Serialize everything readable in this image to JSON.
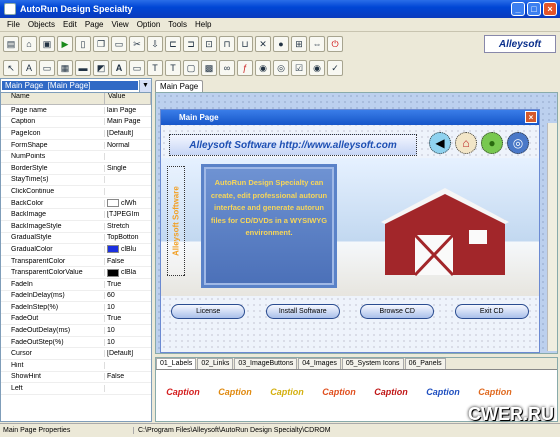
{
  "window": {
    "title": "AutoRun Design Specialty"
  },
  "menu": [
    "File",
    "Objects",
    "Edit",
    "Page",
    "View",
    "Option",
    "Tools",
    "Help"
  ],
  "toolbar1_icons": [
    "new-icon",
    "open-icon",
    "save-icon",
    "run-icon",
    "page-icon",
    "copy-icon",
    "paste-icon",
    "cut-icon",
    "import-icon",
    "align-left-icon",
    "align-right-icon",
    "align-center-icon",
    "align-top-icon",
    "align-bottom-icon",
    "delete-icon",
    "lock-icon",
    "resize-icon",
    "spacing-icon",
    "power-icon"
  ],
  "toolbar2_icons": [
    "pointer-icon",
    "text-icon",
    "label-icon",
    "image-icon",
    "panel-icon",
    "shape-icon",
    "bold-text-icon",
    "line-icon",
    "text-box-icon",
    "rich-text-icon",
    "button-icon",
    "image-button-icon",
    "link-icon",
    "flash-icon",
    "media-icon",
    "browser-icon",
    "checkbox-icon",
    "radio-icon",
    "tick-icon"
  ],
  "brand": "Alleysoft",
  "properties": {
    "object_selected": "Main Page",
    "object_type": "[Main Page]",
    "col_name": "Name",
    "col_value": "Value",
    "rows": [
      {
        "name": "Page name",
        "value": "lain Page"
      },
      {
        "name": "Caption",
        "value": "Main Page"
      },
      {
        "name": "PageIcon",
        "value": "[Default]"
      },
      {
        "name": "FormShape",
        "value": "Normal"
      },
      {
        "name": "NumPoints",
        "value": ""
      },
      {
        "name": "BorderStyle",
        "value": "Single"
      },
      {
        "name": "StayTime(s)",
        "value": ""
      },
      {
        "name": "ClickContinue",
        "value": ""
      },
      {
        "name": "BackColor",
        "value": "clWh",
        "swatch": "#ffffff"
      },
      {
        "name": "BackImage",
        "value": "[TJPEGIm"
      },
      {
        "name": "BackImageStyle",
        "value": "Stretch"
      },
      {
        "name": "GradualStyle",
        "value": "TopBotton"
      },
      {
        "name": "GradualColor",
        "value": "clBlu",
        "swatch": "#1b2fe0"
      },
      {
        "name": "TransparentColor",
        "value": "False"
      },
      {
        "name": "TransparentColorValue",
        "value": "clBla",
        "swatch": "#000000"
      },
      {
        "name": "FadeIn",
        "value": "True"
      },
      {
        "name": "FadeInDelay(ms)",
        "value": "60"
      },
      {
        "name": "FadeInStep(%)",
        "value": "10"
      },
      {
        "name": "FadeOut",
        "value": "True"
      },
      {
        "name": "FadeOutDelay(ms)",
        "value": "10"
      },
      {
        "name": "FadeOutStep(%)",
        "value": "10"
      },
      {
        "name": "Cursor",
        "value": "[Default]"
      },
      {
        "name": "Hint",
        "value": ""
      },
      {
        "name": "ShowHint",
        "value": "False"
      },
      {
        "name": "Left",
        "value": ""
      }
    ]
  },
  "canvas": {
    "tab": "Main Page",
    "form_title": "Main Page",
    "banner": "Alleysoft Software http://www.alleysoft.com",
    "side_label": "Alleysoft Software",
    "description": "AutoRun Design Specialty can create, edit professional autorun interface and generate autorun files for CD/DVDs in a WYSIWYG environment.",
    "buttons": [
      "License",
      "Install Software",
      "Browse CD",
      "Exit CD"
    ]
  },
  "lower": {
    "tabs": [
      "01_Labels",
      "02_Links",
      "03_ImageButtons",
      "04_Images",
      "05_System Icons",
      "06_Panels"
    ],
    "captions": [
      {
        "text": "Caption",
        "color": "#d42020"
      },
      {
        "text": "Caption",
        "color": "#e08a10"
      },
      {
        "text": "Caption",
        "color": "#d4b010"
      },
      {
        "text": "Caption",
        "color": "#e05020"
      },
      {
        "text": "Caption",
        "color": "#c01818"
      },
      {
        "text": "Caption",
        "color": "#2050c0"
      },
      {
        "text": "Caption",
        "color": "#e06a20"
      }
    ]
  },
  "status": {
    "left": "Main Page Properties",
    "right": "C:\\Program Files\\Alleysoft\\AutoRun Design Specialty\\CDROM"
  },
  "watermark": "CWER.RU"
}
